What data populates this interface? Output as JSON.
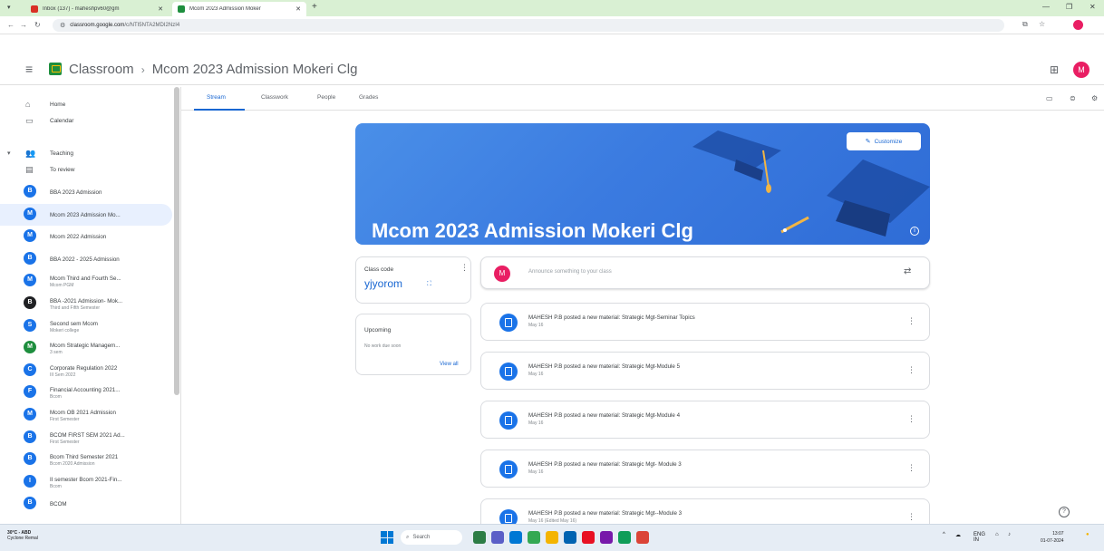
{
  "browser": {
    "tabs": [
      {
        "title": "Inbox (137) - maheshpv60@gm",
        "active": false
      },
      {
        "title": "Mcom 2023 Admission Moker",
        "active": true
      }
    ],
    "url_host": "classroom.google.com",
    "url_path": "/c/NTI5NTA2MDI2NzI4"
  },
  "header": {
    "app_name": "Classroom",
    "separator": "›",
    "class_name": "Mcom 2023 Admission Mokeri Clg",
    "user_initial": "M"
  },
  "sidebar": {
    "nav": [
      {
        "label": "Home",
        "icon": "home-icon"
      },
      {
        "label": "Calendar",
        "icon": "calendar-icon"
      }
    ],
    "teaching_label": "Teaching",
    "to_review_label": "To review",
    "courses": [
      {
        "initial": "B",
        "title": "BBA 2023 Admission",
        "subtitle": "",
        "color": "#1a73e8"
      },
      {
        "initial": "M",
        "title": "Mcom 2023 Admission Mo...",
        "subtitle": "",
        "color": "#1a73e8",
        "active": true
      },
      {
        "initial": "M",
        "title": "Mcom 2022 Admission",
        "subtitle": "",
        "color": "#1a73e8"
      },
      {
        "initial": "B",
        "title": "BBA 2022 - 2025 Admission",
        "subtitle": "",
        "color": "#1a73e8"
      },
      {
        "initial": "M",
        "title": "Mcom Third and Fourth Se...",
        "subtitle": "Mcom PGM",
        "color": "#1a73e8"
      },
      {
        "initial": "B",
        "title": "BBA -2021 Admission- Mok...",
        "subtitle": "Third and Fifth Semester",
        "color": "#202124"
      },
      {
        "initial": "S",
        "title": "Second sem Mcom",
        "subtitle": "Mokeri college",
        "color": "#1a73e8"
      },
      {
        "initial": "M",
        "title": "Mcom Strategic Managem...",
        "subtitle": "3 sem",
        "color": "#1e8e3e"
      },
      {
        "initial": "C",
        "title": "Corporate Regulation 2022",
        "subtitle": "III Sem 2022",
        "color": "#1a73e8"
      },
      {
        "initial": "F",
        "title": "Financial Accounting 2021...",
        "subtitle": "Bcom",
        "color": "#1a73e8"
      },
      {
        "initial": "M",
        "title": "Mcom OB 2021 Admission",
        "subtitle": "First Semester",
        "color": "#1a73e8"
      },
      {
        "initial": "B",
        "title": "BCOM FIRST SEM 2021 Ad...",
        "subtitle": "First Semester",
        "color": "#1a73e8"
      },
      {
        "initial": "B",
        "title": "Bcom Third Semester 2021",
        "subtitle": "Bcom 2020 Admission",
        "color": "#1a73e8"
      },
      {
        "initial": "I",
        "title": "II semester Bcom 2021-Fin...",
        "subtitle": "Bcom",
        "color": "#1a73e8"
      },
      {
        "initial": "B",
        "title": "BCOM",
        "subtitle": "",
        "color": "#1a73e8"
      }
    ]
  },
  "class_tabs": [
    "Stream",
    "Classwork",
    "People",
    "Grades"
  ],
  "banner": {
    "title": "Mcom 2023 Admission Mokeri Clg",
    "customize_label": "Customize"
  },
  "class_code": {
    "label": "Class code",
    "code": "yjyorom"
  },
  "upcoming": {
    "label": "Upcoming",
    "empty_text": "No work due soon",
    "view_all": "View all"
  },
  "announce": {
    "placeholder": "Announce something to your class",
    "avatar": "M"
  },
  "posts": [
    {
      "title": "MAHESH P.B posted a new material: Strategic Mgt-Seminar Topics",
      "date": "May 16"
    },
    {
      "title": "MAHESH P.B posted a new material: Strategic Mgt-Module 5",
      "date": "May 16"
    },
    {
      "title": "MAHESH P.B posted a new material: Strategic Mgt-Module 4",
      "date": "May 16"
    },
    {
      "title": "MAHESH P.B posted a new material: Strategic Mgt- Module 3",
      "date": "May 16"
    },
    {
      "title": "MAHESH P.B posted a new material: Strategic Mgt--Module 3",
      "date": "May 16 (Edited May 16)"
    }
  ],
  "taskbar": {
    "weather_temp": "30°C - ABD",
    "weather_desc": "Cyclone Remal",
    "search_label": "Search",
    "lang": "ENG",
    "lang_sub": "IN",
    "time": "13:07",
    "date": "01-07-2024"
  }
}
